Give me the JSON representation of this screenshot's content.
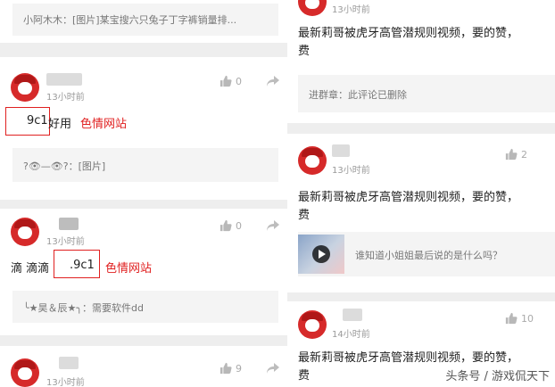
{
  "left_column": {
    "top_reply": "小阿木木：[图片]某宝搜六只兔子丁字裤销量排...",
    "comment1": {
      "time": "13小时前",
      "likes": "0",
      "text_redacted": "9c1",
      "text_after": "好用",
      "annotation": "色情网站",
      "reply": "?👁—👁?：[图片]"
    },
    "comment2": {
      "time": "13小时前",
      "likes": "0",
      "text_before": "滴 滴滴",
      "text_redacted": ".9c1",
      "annotation": "色情网站",
      "reply": "╰★昊＆辰★╮：需要软件dd"
    },
    "comment3": {
      "time": "13小时前",
      "likes": "9"
    }
  },
  "right_column": {
    "comment_top": {
      "time": "13小时前",
      "text_line1": "最新莉哥被虎牙高管潜规则视频，要的赞，",
      "text_line2": "费",
      "reply": "进群章：此评论已删除"
    },
    "comment_mid": {
      "time": "13小时前",
      "likes": "2",
      "text_line1": "最新莉哥被虎牙高管潜规则视频，要的赞，",
      "text_line2": "费",
      "video_reply": "谁知道小姐姐最后说的是什么吗？"
    },
    "comment_bottom": {
      "time": "14小时前",
      "likes": "10",
      "text_line1": "最新莉哥被虎牙高管潜规则视频，要的赞，",
      "text_line2": "费"
    }
  },
  "watermark": "头条号 / 游戏侃天下",
  "colors": {
    "annotation_red": "#e02020",
    "avatar_red": "#d62a2a",
    "background": "#eeeeee"
  }
}
